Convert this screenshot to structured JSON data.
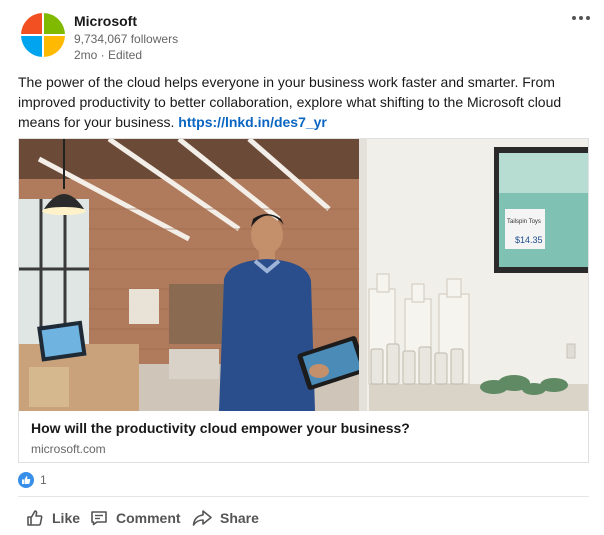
{
  "post": {
    "author": "Microsoft",
    "followers": "9,734,067 followers",
    "meta": "2mo · Edited",
    "text": "The power of the cloud helps everyone in your business work faster and smarter. From improved productivity to better collaboration, explore what shifting to the Microsoft cloud means for your business. ",
    "link_text": "https://lnkd.in/des7_yr"
  },
  "preview": {
    "title": "How will the productivity cloud empower your business?",
    "domain": "microsoft.com",
    "tv_text_line1": "Tailspin Toys",
    "tv_text_line2": "$14.35"
  },
  "reactions": {
    "count": "1"
  },
  "actions": {
    "like": "Like",
    "comment": "Comment",
    "share": "Share"
  },
  "icons": {
    "more": "more-horizontal-icon",
    "like": "thumbs-up-icon",
    "comment": "comment-icon",
    "share": "share-arrow-icon"
  },
  "colors": {
    "link": "#0a66c2",
    "like_badge": "#378fe9",
    "logo_red": "#f25022",
    "logo_green": "#7fba00",
    "logo_blue": "#00a4ef",
    "logo_yellow": "#ffb900"
  }
}
